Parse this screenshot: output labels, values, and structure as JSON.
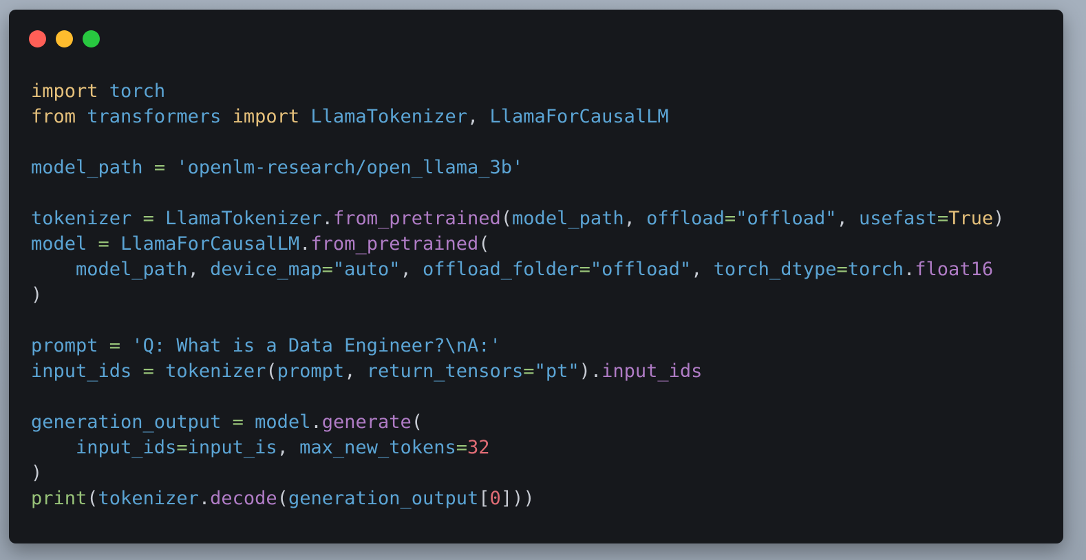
{
  "window": {
    "controls": [
      {
        "name": "close",
        "color": "#ff5f57"
      },
      {
        "name": "minimize",
        "color": "#febc2e"
      },
      {
        "name": "maximize",
        "color": "#28c840"
      }
    ]
  },
  "colors": {
    "keyword": "#e5c07b",
    "identifier": "#5ba4d4",
    "operator": "#98c379",
    "string": "#5ba4d4",
    "method": "#b07cc6",
    "number": "#e06c75",
    "builtin": "#98c379",
    "punct": "#c8ccd4",
    "constant": "#e5c07b"
  },
  "code_lines": [
    [
      [
        "kw",
        "import"
      ],
      [
        "id",
        " torch"
      ]
    ],
    [
      [
        "kw",
        "from"
      ],
      [
        "id",
        " transformers "
      ],
      [
        "kw",
        "import"
      ],
      [
        "id",
        " LlamaTokenizer"
      ],
      [
        "p",
        ", "
      ],
      [
        "id",
        "LlamaForCausalLM"
      ]
    ],
    [],
    [
      [
        "id",
        "model_path "
      ],
      [
        "op",
        "="
      ],
      [
        "str",
        " 'openlm-research/open_llama_3b'"
      ]
    ],
    [],
    [
      [
        "id",
        "tokenizer "
      ],
      [
        "op",
        "="
      ],
      [
        "id",
        " LlamaTokenizer"
      ],
      [
        "p",
        "."
      ],
      [
        "m",
        "from_pretrained"
      ],
      [
        "p",
        "("
      ],
      [
        "id",
        "model_path"
      ],
      [
        "p",
        ", "
      ],
      [
        "id",
        "offload"
      ],
      [
        "op",
        "="
      ],
      [
        "str",
        "\"offload\""
      ],
      [
        "p",
        ", "
      ],
      [
        "id",
        "usefast"
      ],
      [
        "op",
        "="
      ],
      [
        "const",
        "True"
      ],
      [
        "p",
        ")"
      ]
    ],
    [
      [
        "id",
        "model "
      ],
      [
        "op",
        "="
      ],
      [
        "id",
        " LlamaForCausalLM"
      ],
      [
        "p",
        "."
      ],
      [
        "m",
        "from_pretrained"
      ],
      [
        "p",
        "("
      ]
    ],
    [
      [
        "id",
        "    model_path"
      ],
      [
        "p",
        ", "
      ],
      [
        "id",
        "device_map"
      ],
      [
        "op",
        "="
      ],
      [
        "str",
        "\"auto\""
      ],
      [
        "p",
        ", "
      ],
      [
        "id",
        "offload_folder"
      ],
      [
        "op",
        "="
      ],
      [
        "str",
        "\"offload\""
      ],
      [
        "p",
        ", "
      ],
      [
        "id",
        "torch_dtype"
      ],
      [
        "op",
        "="
      ],
      [
        "id",
        "torch"
      ],
      [
        "p",
        "."
      ],
      [
        "m",
        "float16"
      ]
    ],
    [
      [
        "p",
        ")"
      ]
    ],
    [],
    [
      [
        "id",
        "prompt "
      ],
      [
        "op",
        "="
      ],
      [
        "str",
        " 'Q: What is a Data Engineer?\\nA:'"
      ]
    ],
    [
      [
        "id",
        "input_ids "
      ],
      [
        "op",
        "="
      ],
      [
        "id",
        " tokenizer"
      ],
      [
        "p",
        "("
      ],
      [
        "id",
        "prompt"
      ],
      [
        "p",
        ", "
      ],
      [
        "id",
        "return_tensors"
      ],
      [
        "op",
        "="
      ],
      [
        "str",
        "\"pt\""
      ],
      [
        "p",
        ")."
      ],
      [
        "m",
        "input_ids"
      ]
    ],
    [],
    [
      [
        "id",
        "generation_output "
      ],
      [
        "op",
        "="
      ],
      [
        "id",
        " model"
      ],
      [
        "p",
        "."
      ],
      [
        "m",
        "generate"
      ],
      [
        "p",
        "("
      ]
    ],
    [
      [
        "id",
        "    input_ids"
      ],
      [
        "op",
        "="
      ],
      [
        "id",
        "input_is"
      ],
      [
        "p",
        ", "
      ],
      [
        "id",
        "max_new_tokens"
      ],
      [
        "op",
        "="
      ],
      [
        "num",
        "32"
      ]
    ],
    [
      [
        "p",
        ")"
      ]
    ],
    [
      [
        "bi",
        "print"
      ],
      [
        "p",
        "("
      ],
      [
        "id",
        "tokenizer"
      ],
      [
        "p",
        "."
      ],
      [
        "m",
        "decode"
      ],
      [
        "p",
        "("
      ],
      [
        "id",
        "generation_output"
      ],
      [
        "p",
        "["
      ],
      [
        "num",
        "0"
      ],
      [
        "p",
        "]))"
      ]
    ]
  ]
}
